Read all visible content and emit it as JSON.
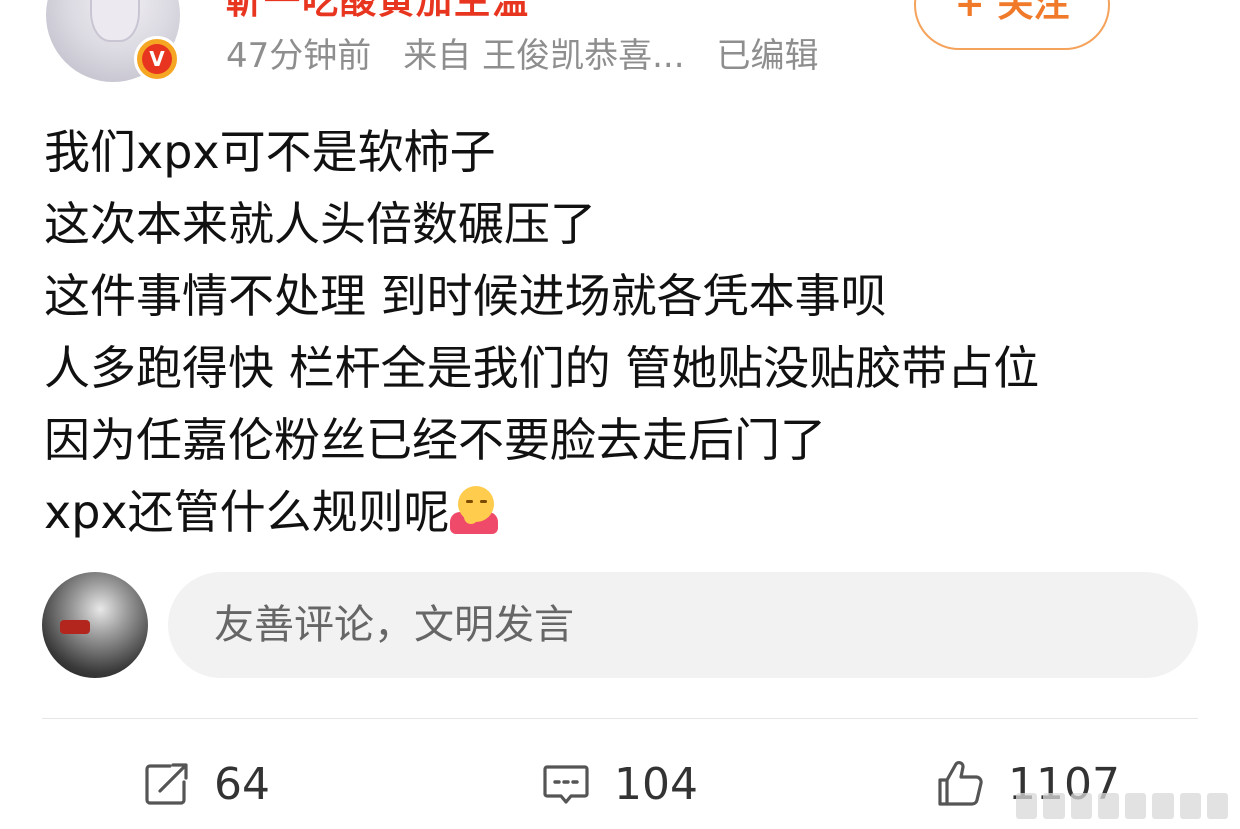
{
  "author": {
    "name": "靳一吃酸黄加生温",
    "avatar_icon": "user-avatar",
    "verified_icon": "verified-badge",
    "verified_mark": "V",
    "follow_label": "+ 关注"
  },
  "meta": {
    "time": "47分钟前",
    "source": "来自 王俊凯恭喜...",
    "edited": "已编辑"
  },
  "post": {
    "lines": [
      "我们xpx可不是软柿子",
      "这次本来就人头倍数碾压了",
      "这件事情不处理 到时候进场就各凭本事呗",
      "人多跑得快 栏杆全是我们的 管她贴没贴胶带占位",
      "因为任嘉伦粉丝已经不要脸去走后门了",
      "xpx还管什么规则呢"
    ],
    "trailing_emoji": "hugging-face-emoji"
  },
  "comment_box": {
    "placeholder": "友善评论，文明发言",
    "avatar_icon": "commenter-avatar"
  },
  "actions": {
    "repost_count": "64",
    "comment_count": "104",
    "like_count": "1107",
    "repost_icon": "repost-icon",
    "comment_icon": "comment-icon",
    "like_icon": "like-icon"
  },
  "colors": {
    "name": "#e8351f",
    "follow": "#f07a2a",
    "meta": "#8e8e8e",
    "badge_outer": "#f5a623",
    "badge_inner": "#e8351f"
  }
}
